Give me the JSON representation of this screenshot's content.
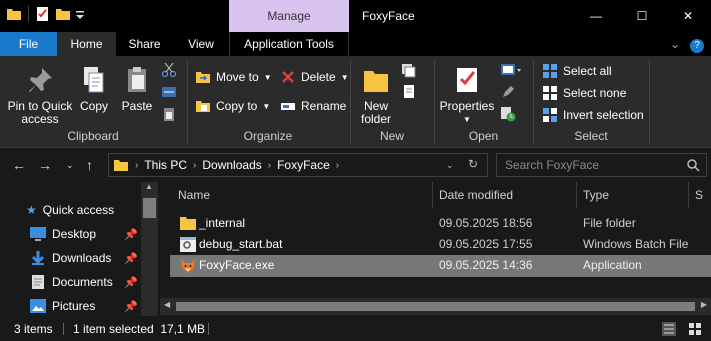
{
  "window": {
    "title": "FoxyFace",
    "context_tab": "Manage",
    "controls": {
      "minimize": "—",
      "maximize": "☐",
      "close": "✕"
    }
  },
  "ribbon_tabs": {
    "file": "File",
    "home": "Home",
    "share": "Share",
    "view": "View",
    "application_tools": "Application Tools",
    "expand": "⌄",
    "help": "?"
  },
  "ribbon": {
    "clipboard": {
      "label": "Clipboard",
      "pin_line1": "Pin to Quick",
      "pin_line2": "access",
      "copy": "Copy",
      "paste": "Paste"
    },
    "organize": {
      "label": "Organize",
      "move_to": "Move to",
      "copy_to": "Copy to",
      "delete": "Delete",
      "rename": "Rename"
    },
    "new": {
      "label": "New",
      "new_folder_line1": "New",
      "new_folder_line2": "folder"
    },
    "open": {
      "label": "Open",
      "properties": "Properties"
    },
    "select": {
      "label": "Select",
      "select_all": "Select all",
      "select_none": "Select none",
      "invert_selection": "Invert selection"
    }
  },
  "address": {
    "crumbs": [
      "This PC",
      "Downloads",
      "FoxyFace"
    ],
    "search_placeholder": "Search FoxyFace"
  },
  "nav_pane": {
    "items": [
      {
        "label": "Quick access",
        "icon": "star-icon"
      },
      {
        "label": "Desktop",
        "icon": "desktop-icon"
      },
      {
        "label": "Downloads",
        "icon": "download-icon"
      },
      {
        "label": "Documents",
        "icon": "documents-icon"
      },
      {
        "label": "Pictures",
        "icon": "pictures-icon"
      }
    ]
  },
  "file_list": {
    "columns": {
      "name": "Name",
      "date": "Date modified",
      "type": "Type",
      "size": "S"
    },
    "rows": [
      {
        "name": "_internal",
        "date": "09.05.2025 18:56",
        "type": "File folder",
        "icon": "folder-icon",
        "selected": false
      },
      {
        "name": "debug_start.bat",
        "date": "09.05.2025 17:55",
        "type": "Windows Batch File",
        "icon": "batch-file-icon",
        "selected": false
      },
      {
        "name": "FoxyFace.exe",
        "date": "09.05.2025 14:36",
        "type": "Application",
        "icon": "fox-app-icon",
        "selected": true
      }
    ]
  },
  "status_bar": {
    "items_count": "3 items",
    "selected_info": "1 item selected  17,1 MB"
  },
  "colors": {
    "background": "#191919",
    "ribbon": "#2b2b2b",
    "file_tab": "#1979ca",
    "context_tab": "#d9c4f0",
    "selection": "#777777"
  }
}
